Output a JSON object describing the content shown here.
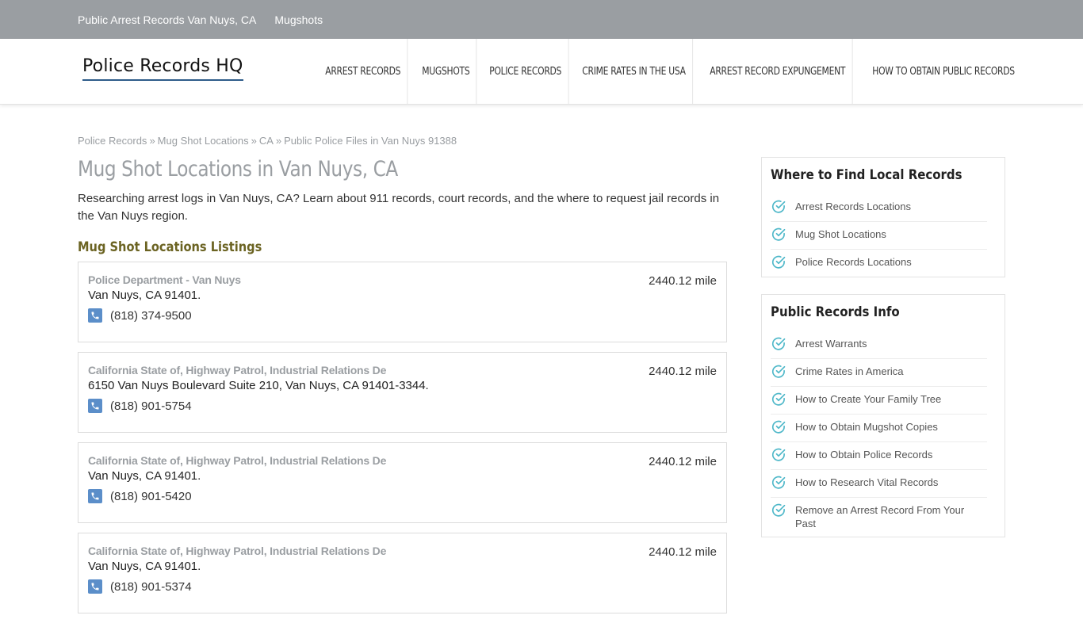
{
  "topbar": {
    "links": [
      "Public Arrest Records Van Nuys, CA",
      "Mugshots"
    ]
  },
  "header": {
    "logo_text": "Police Records HQ",
    "nav": [
      "ARREST RECORDS",
      "MUGSHOTS",
      "POLICE RECORDS",
      "CRIME RATES IN THE USA",
      "ARREST RECORD EXPUNGEMENT",
      "HOW TO OBTAIN PUBLIC RECORDS"
    ]
  },
  "breadcrumb": {
    "items": [
      "Police Records",
      "Mug Shot Locations",
      "CA",
      "Public Police Files in Van Nuys 91388"
    ],
    "separator": "»"
  },
  "main": {
    "title": "Mug Shot Locations in Van Nuys, CA",
    "intro": "Researching arrest logs in Van Nuys, CA? Learn about 911 records, court records, and the where to request jail records in the Van Nuys region.",
    "section_title": "Mug Shot Locations Listings",
    "listings": [
      {
        "name": "Police Department - Van Nuys",
        "distance": "2440.12 mile",
        "address": "Van Nuys, CA 91401.",
        "phone": "(818) 374-9500"
      },
      {
        "name": "California State of, Highway Patrol, Industrial Relations De",
        "distance": "2440.12 mile",
        "address": "6150 Van Nuys Boulevard Suite 210, Van Nuys, CA 91401-3344.",
        "phone": "(818) 901-5754"
      },
      {
        "name": "California State of, Highway Patrol, Industrial Relations De",
        "distance": "2440.12 mile",
        "address": "Van Nuys, CA 91401.",
        "phone": "(818) 901-5420"
      },
      {
        "name": "California State of, Highway Patrol, Industrial Relations De",
        "distance": "2440.12 mile",
        "address": "Van Nuys, CA 91401.",
        "phone": "(818) 901-5374"
      }
    ]
  },
  "sidebar": {
    "widgets": [
      {
        "title": "Where to Find Local Records",
        "items": [
          "Arrest Records Locations",
          "Mug Shot Locations",
          "Police Records Locations"
        ]
      },
      {
        "title": "Public Records Info",
        "items": [
          "Arrest Warrants",
          "Crime Rates in America",
          "How to Create Your Family Tree",
          "How to Obtain Mugshot Copies",
          "How to Obtain Police Records",
          "How to Research Vital Records",
          "Remove an Arrest Record From Your Past"
        ]
      }
    ]
  },
  "colors": {
    "topbar_bg": "#9a9ea2",
    "phone_icon_bg": "#5b8ec9",
    "check_icon": "#4fb8c9",
    "section_title": "#6b6322",
    "logo_underline": "#2e5c8a"
  },
  "icons": {
    "phone": "phone-icon",
    "check": "check-circle-icon"
  }
}
